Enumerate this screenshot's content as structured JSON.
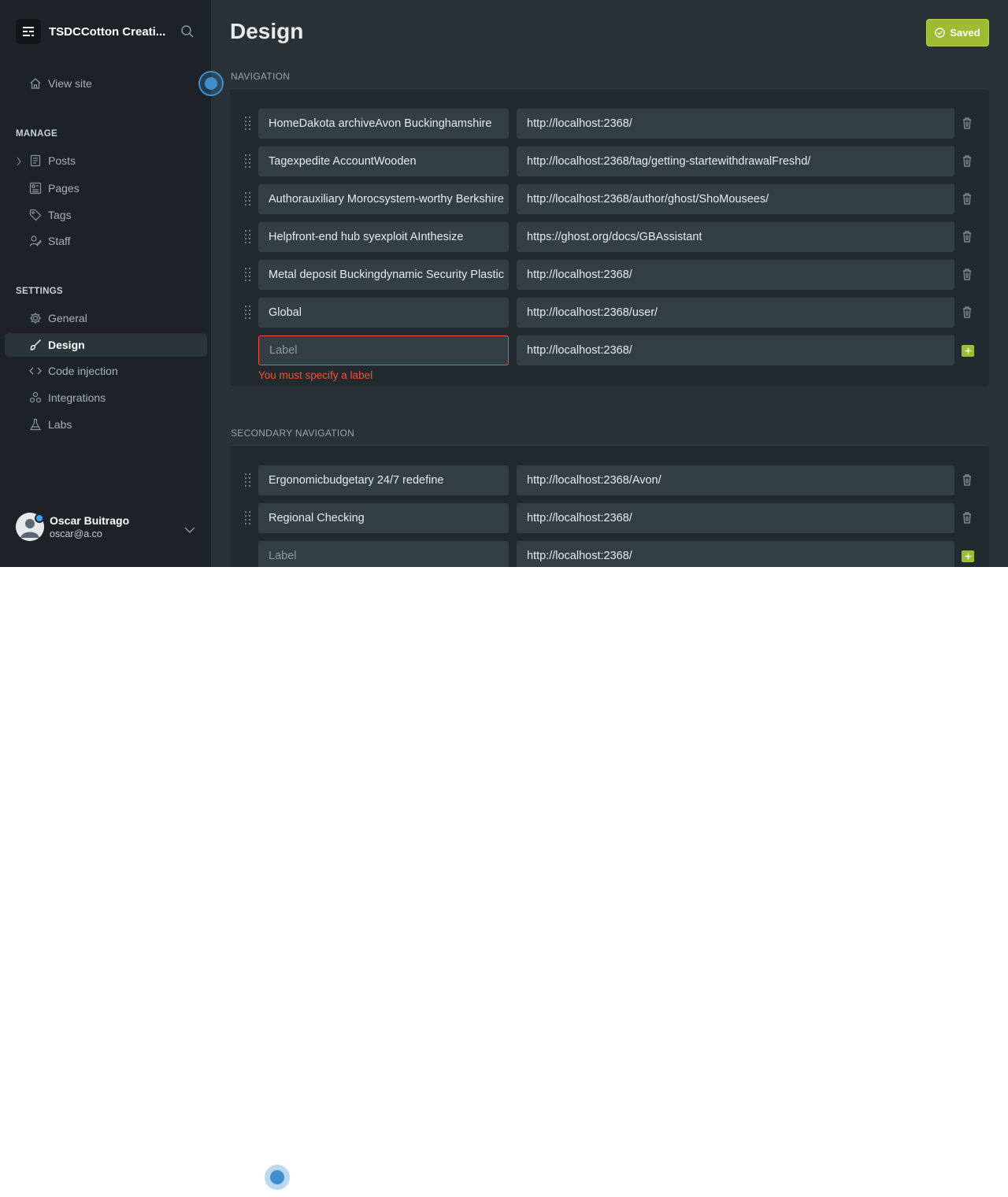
{
  "sidebar": {
    "site_title": "TSDCCotton Creati...",
    "view_site": "View site",
    "manage_heading": "MANAGE",
    "settings_heading": "SETTINGS",
    "manage_items": [
      {
        "label": "Posts",
        "icon": "posts-icon"
      },
      {
        "label": "Pages",
        "icon": "pages-icon"
      },
      {
        "label": "Tags",
        "icon": "tag-icon"
      },
      {
        "label": "Staff",
        "icon": "staff-icon"
      }
    ],
    "settings_items": [
      {
        "label": "General",
        "icon": "gear-icon"
      },
      {
        "label": "Design",
        "icon": "brush-icon",
        "active": true
      },
      {
        "label": "Code injection",
        "icon": "code-icon"
      },
      {
        "label": "Integrations",
        "icon": "integrations-icon"
      },
      {
        "label": "Labs",
        "icon": "flask-icon"
      }
    ],
    "user": {
      "name": "Oscar Buitrago",
      "email": "oscar@a.co"
    }
  },
  "header": {
    "title": "Design",
    "saved_label": "Saved"
  },
  "navigation": {
    "heading": "NAVIGATION",
    "items": [
      {
        "label": "HomeDakota archiveAvon Buckinghamshire",
        "url": "http://localhost:2368/"
      },
      {
        "label": "Tagexpedite AccountWooden",
        "url": "http://localhost:2368/tag/getting-startewithdrawalFreshd/"
      },
      {
        "label": "Authorauxiliary Morocsystem-worthy Berkshire",
        "url": "http://localhost:2368/author/ghost/ShoMousees/"
      },
      {
        "label": "Helpfront-end hub syexploit AInthesize",
        "url": "https://ghost.org/docs/GBAssistant"
      },
      {
        "label": "Metal deposit Buckingdynamic Security Plastic",
        "url": "http://localhost:2368/"
      },
      {
        "label": "Global",
        "url": "http://localhost:2368/user/"
      }
    ],
    "new_item": {
      "label_placeholder": "Label",
      "url": "http://localhost:2368/",
      "error": "You must specify a label"
    }
  },
  "secondary_navigation": {
    "heading": "SECONDARY NAVIGATION",
    "items": [
      {
        "label": "Ergonomicbudgetary 24/7 redefine",
        "url": "http://localhost:2368/Avon/"
      },
      {
        "label": "Regional Checking",
        "url": "http://localhost:2368/"
      }
    ],
    "new_item": {
      "label_placeholder": "Label",
      "url": "http://localhost:2368/"
    }
  },
  "colors": {
    "sidebar_bg": "#1c2228",
    "main_bg": "#2a3237",
    "accent_green": "#9fbb33",
    "error_red": "#f05230",
    "cursor_blue": "#3f8fcf"
  }
}
